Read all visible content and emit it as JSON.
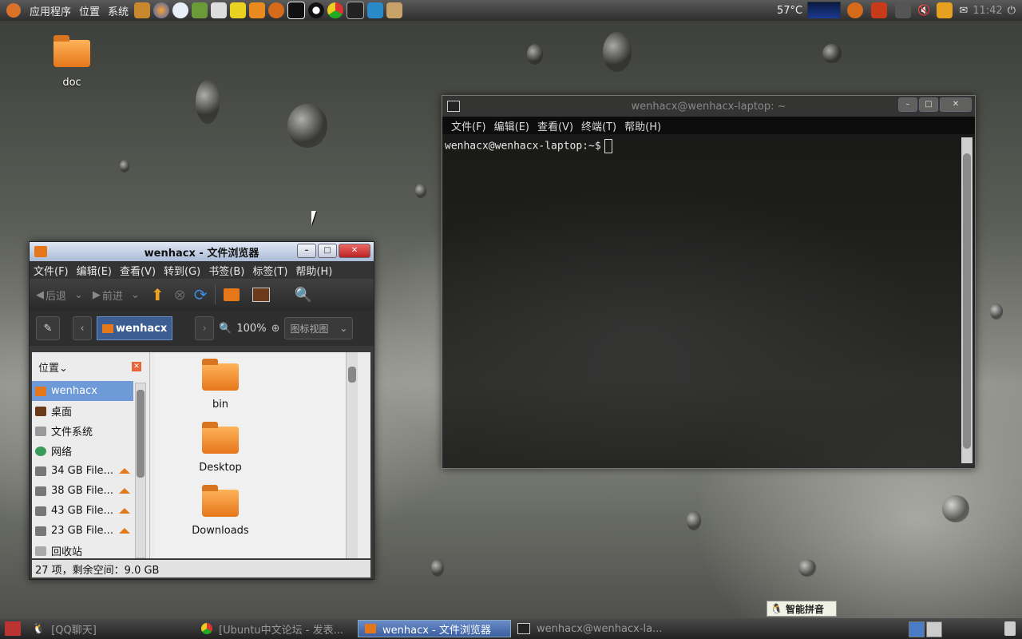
{
  "top_panel": {
    "menus": [
      "应用程序",
      "位置",
      "系统"
    ],
    "temperature": "57°C",
    "clock": "11:42"
  },
  "desktop": {
    "icons": [
      {
        "label": "doc"
      }
    ]
  },
  "file_browser": {
    "title": "wenhacx - 文件浏览器",
    "menus": [
      "文件(F)",
      "编辑(E)",
      "查看(V)",
      "转到(G)",
      "书签(B)",
      "标签(T)",
      "帮助(H)"
    ],
    "toolbar": {
      "back": "后退",
      "forward": "前进"
    },
    "location": {
      "crumb": "wenhacx",
      "zoom": "100%",
      "view_mode": "图标视图"
    },
    "sidebar": {
      "header": "位置",
      "items": [
        {
          "label": "wenhacx",
          "selected": true
        },
        {
          "label": "桌面"
        },
        {
          "label": "文件系统"
        },
        {
          "label": "网络"
        },
        {
          "label": "34 GB File...",
          "eject": true
        },
        {
          "label": "38 GB File...",
          "eject": true
        },
        {
          "label": "43 GB File...",
          "eject": true
        },
        {
          "label": "23 GB File...",
          "eject": true
        },
        {
          "label": "回收站"
        }
      ]
    },
    "files": [
      "bin",
      "Desktop",
      "Downloads"
    ],
    "status": "27 项，剩余空间：9.0 GB"
  },
  "terminal": {
    "title": "wenhacx@wenhacx-laptop: ~",
    "menus": [
      "文件(F)",
      "编辑(E)",
      "查看(V)",
      "终端(T)",
      "帮助(H)"
    ],
    "prompt": "wenhacx@wenhacx-laptop:~$"
  },
  "ime": {
    "label": "智能拼音"
  },
  "bottom_panel": {
    "tasks": [
      {
        "label": "[QQ聊天]",
        "active": false
      },
      {
        "label": "[Ubuntu中文论坛 - 发表...",
        "active": false
      },
      {
        "label": "wenhacx - 文件浏览器",
        "active": true
      },
      {
        "label": "wenhacx@wenhacx-la...",
        "active": false
      }
    ]
  },
  "colors": {
    "selection": "#6f9ad8",
    "folder": "#e6761a",
    "active_task": "#3a5ea0"
  }
}
